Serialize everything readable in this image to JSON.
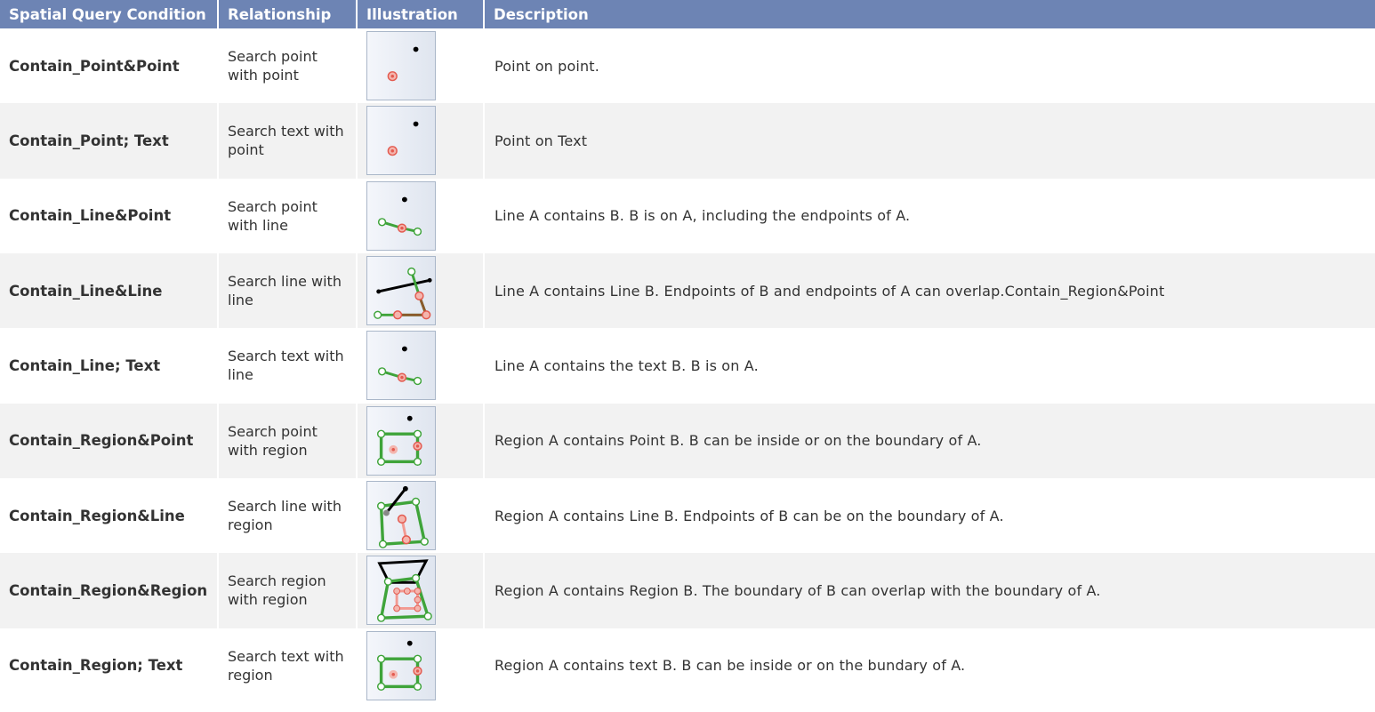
{
  "header": {
    "condition": "Spatial Query Condition",
    "relationship": "Relationship",
    "illustration": "Illustration",
    "description": "Description"
  },
  "rows": [
    {
      "condition": "Contain_Point&Point",
      "relationship": "Search point with point",
      "description": "Point on point.",
      "illustration": "point-point-illustration"
    },
    {
      "condition": "Contain_Point; Text",
      "relationship": "Search text with point",
      "description": "Point on Text",
      "illustration": "point-text-illustration"
    },
    {
      "condition": "Contain_Line&Point",
      "relationship": "Search point with line",
      "description": "Line A contains B. B is on A, including the endpoints of A.",
      "illustration": "line-point-illustration"
    },
    {
      "condition": "Contain_Line&Line",
      "relationship": "Search line with line",
      "description": "Line A contains Line B. Endpoints of B and endpoints of A can overlap.Contain_Region&Point",
      "illustration": "line-line-illustration"
    },
    {
      "condition": "Contain_Line; Text",
      "relationship": "Search text with line",
      "description": "Line A contains the text B. B is on A.",
      "illustration": "line-text-illustration"
    },
    {
      "condition": "Contain_Region&Point",
      "relationship": "Search point with region",
      "description": "Region A contains Point B. B can be inside or on the boundary of A.",
      "illustration": "region-point-illustration"
    },
    {
      "condition": "Contain_Region&Line",
      "relationship": "Search line with region",
      "description": "Region A contains Line B. Endpoints of B can be on the boundary of A.",
      "illustration": "region-line-illustration"
    },
    {
      "condition": "Contain_Region&Region",
      "relationship": "Search region with region",
      "description": "Region A contains Region B. The boundary of B can overlap with the boundary of A.",
      "illustration": "region-region-illustration"
    },
    {
      "condition": "Contain_Region; Text",
      "relationship": "Search text with region",
      "description": "Region A contains text B. B can be inside or on the bundary of A.",
      "illustration": "region-text-illustration"
    }
  ],
  "colors": {
    "header_bg": "#6d84b4",
    "row_alt_bg": "#f2f2f2",
    "line_green": "#3fa43a",
    "point_red": "#e35a4f",
    "point_black": "#000000",
    "line_brown": "#8b5a2b"
  }
}
